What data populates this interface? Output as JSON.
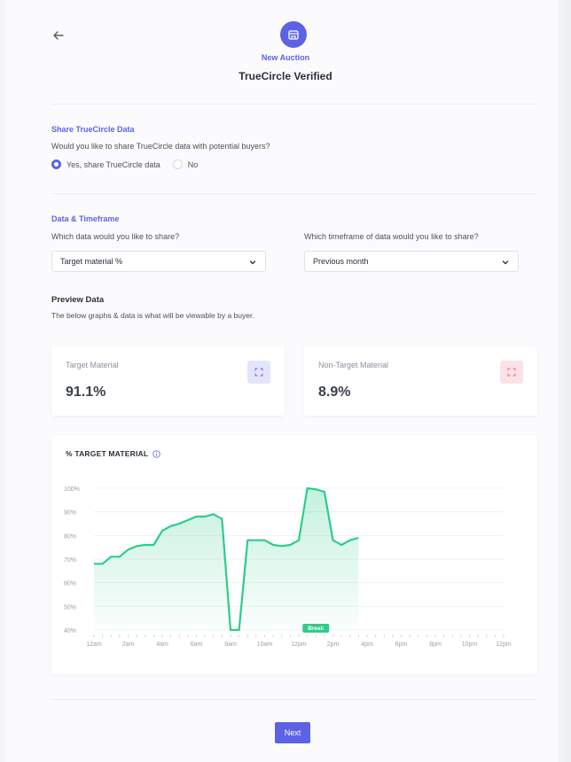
{
  "header": {
    "subtitle": "New Auction",
    "title": "TrueCircle Verified"
  },
  "share": {
    "heading": "Share TrueCircle Data",
    "question": "Would you like to share TrueCircle data with potential buyers?",
    "options": [
      {
        "label": "Yes, share TrueCircle data",
        "selected": true
      },
      {
        "label": "No",
        "selected": false
      }
    ]
  },
  "data_timeframe": {
    "heading": "Data & Timeframe",
    "data_question": "Which data would you like to share?",
    "data_value": "Target material %",
    "timeframe_question": "Which timeframe of data would you like to share?",
    "timeframe_value": "Previous month"
  },
  "preview": {
    "title": "Preview Data",
    "subtitle": "The below graphs & data is what will be viewable by a buyer."
  },
  "metrics": [
    {
      "label": "Target Material",
      "value": "91.1%",
      "accent": "#5b63e4",
      "tint": "#e4e5fb",
      "icon": "expand-icon"
    },
    {
      "label": "Non-Target Material",
      "value": "8.9%",
      "accent": "#e46a7c",
      "tint": "#fbe2e6",
      "icon": "expand-icon"
    }
  ],
  "chart_data": {
    "type": "area",
    "title": "% TARGET MATERIAL",
    "xlabel": "",
    "ylabel": "",
    "ylim": [
      40,
      100
    ],
    "yticks": [
      "40%",
      "50%",
      "60%",
      "70%",
      "80%",
      "90%",
      "100%"
    ],
    "xticks": [
      "12am",
      "2am",
      "4am",
      "6am",
      "8am",
      "10am",
      "12pm",
      "2pm",
      "4pm",
      "6pm",
      "8pm",
      "10pm",
      "12pm"
    ],
    "annotation": "Break",
    "line_color": "#2ecc8a",
    "x": [
      0,
      0.5,
      1,
      1.5,
      2,
      2.5,
      3,
      3.5,
      4,
      4.5,
      5,
      5.5,
      6,
      6.5,
      7,
      7.5,
      8,
      8.5,
      9,
      9.5,
      10,
      10.5,
      11,
      11.5,
      12,
      12.5,
      13,
      13.5,
      14,
      14.5,
      15,
      15.5,
      16,
      16.5,
      17,
      17.5,
      18,
      18.5,
      19,
      19.5,
      20,
      20.5,
      21,
      21.5,
      22,
      22.5,
      23
    ],
    "values": [
      68,
      68,
      71,
      71,
      74,
      75.5,
      76,
      76,
      82,
      84,
      85,
      86.5,
      88,
      88,
      89,
      87,
      40,
      40,
      78,
      78,
      78,
      76,
      75.5,
      76,
      78,
      100,
      99.5,
      98.5,
      78,
      76,
      78,
      79,
      null,
      null,
      null,
      null,
      null,
      null,
      null,
      null,
      null,
      null,
      null,
      null,
      null,
      null,
      null
    ]
  },
  "footer": {
    "next_label": "Next"
  }
}
